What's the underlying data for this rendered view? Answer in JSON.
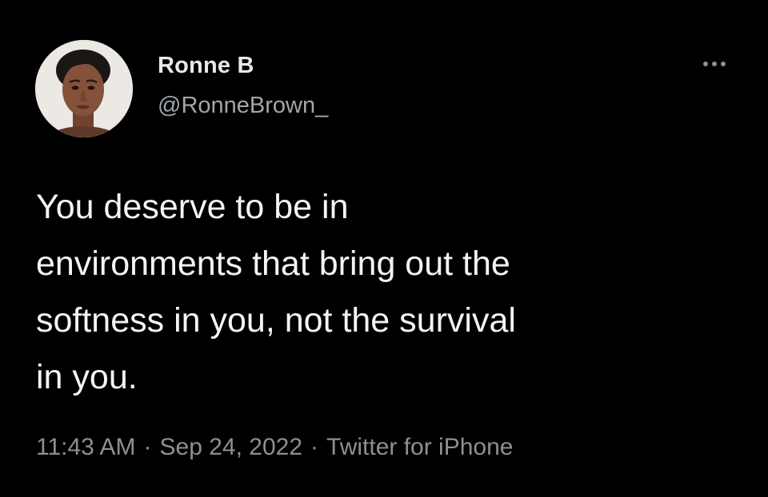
{
  "tweet": {
    "author": {
      "display_name": "Ronne B",
      "handle": "@RonneBrown_",
      "avatar_icon": "profile-photo"
    },
    "more_icon": "more-horizontal-icon",
    "text": "You deserve to be in\nenvironments that bring out the\nsoftness in you, not the survival\nin you.",
    "time": "11:43 AM",
    "separator": "·",
    "date": "Sep 24, 2022",
    "source": "Twitter for iPhone"
  },
  "colors": {
    "background": "#000000",
    "primary_text": "#e7e9ea",
    "secondary_text": "#8b9096"
  }
}
